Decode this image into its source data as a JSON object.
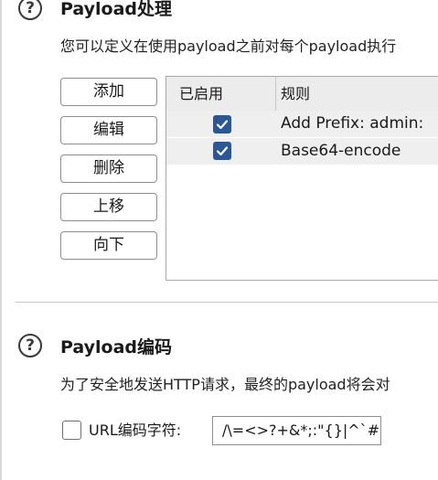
{
  "processing": {
    "title": "Payload处理",
    "description": "您可以定义在使用payload之前对每个payload执行",
    "buttons": {
      "add": "添加",
      "edit": "编辑",
      "remove": "删除",
      "up": "上移",
      "down": "向下"
    },
    "table": {
      "headers": {
        "enabled": "已启用",
        "rule": "规则"
      },
      "rows": [
        {
          "enabled": true,
          "rule": "Add Prefix: admin:"
        },
        {
          "enabled": true,
          "rule": "Base64-encode"
        }
      ]
    }
  },
  "encoding": {
    "title": "Payload编码",
    "description": "为了安全地发送HTTP请求，最终的payload将会对",
    "url_encode_label": "URL编码字符:",
    "url_encode_checked": false,
    "url_encode_chars": "/\\=<>?+&*;:\"{}|^`#"
  },
  "colors": {
    "checkbox": "#2b5797",
    "header_bg": "#ececec",
    "row_bg": "#efefef"
  },
  "icons": {
    "help": "question-circle-icon",
    "check": "checkmark-icon"
  }
}
